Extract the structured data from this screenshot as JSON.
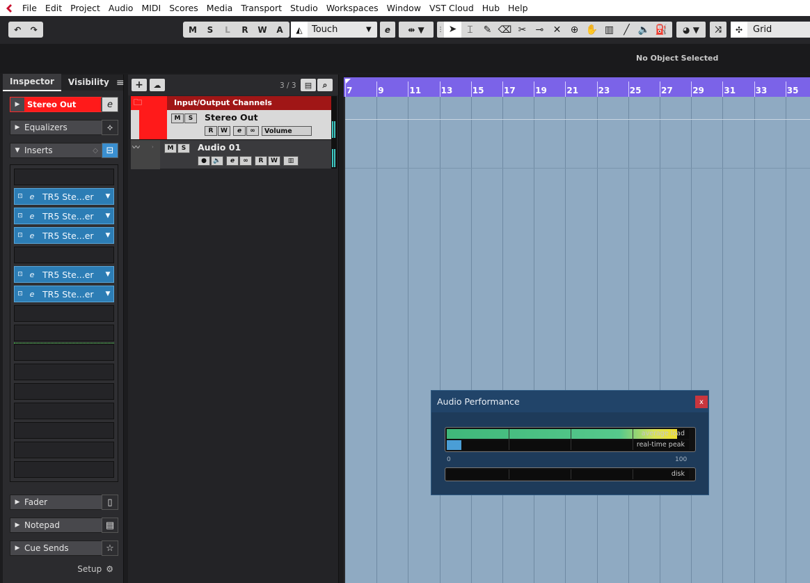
{
  "menu": [
    "File",
    "Edit",
    "Project",
    "Audio",
    "MIDI",
    "Scores",
    "Media",
    "Transport",
    "Studio",
    "Workspaces",
    "Window",
    "VST Cloud",
    "Hub",
    "Help"
  ],
  "toolbar": {
    "states": [
      "M",
      "S",
      "L",
      "R",
      "W",
      "A"
    ],
    "automation_mode": "Touch",
    "snap_mode": "Grid"
  },
  "infoline": {
    "status": "No Object Selected"
  },
  "inspector": {
    "tabs": [
      "Inspector",
      "Visibility"
    ],
    "track_name": "Stereo Out",
    "sections": {
      "equalizers": "Equalizers",
      "inserts": "Inserts",
      "fader": "Fader",
      "notepad": "Notepad",
      "cue_sends": "Cue Sends"
    },
    "insert_slots": [
      "",
      "TR5 Ste...er",
      "TR5 Ste...er",
      "TR5 Ste...er",
      "",
      "TR5 Ste...er",
      "TR5 Ste...er",
      "",
      "",
      "",
      "",
      "",
      "",
      "",
      "",
      ""
    ],
    "setup_label": "Setup"
  },
  "tracklist": {
    "count": "3 / 3",
    "folder_name": "Input/Output Channels",
    "tracks": [
      {
        "name": "Stereo Out",
        "param": "Volume"
      },
      {
        "name": "Audio 01"
      }
    ]
  },
  "ruler": {
    "bars": [
      "7",
      "9",
      "11",
      "13",
      "15",
      "17",
      "19",
      "21",
      "23",
      "25",
      "27",
      "29",
      "31",
      "33",
      "35"
    ]
  },
  "audio_performance": {
    "title": "Audio Performance",
    "close": "x",
    "average_load_label": "average load",
    "average_load": 0.95,
    "peak_label": "real-time peak",
    "peak": 0.06,
    "scale_min": "0",
    "scale_max": "100",
    "disk_label": "disk",
    "disk": 0.0
  },
  "colors": {
    "ruler": "#7b63e8",
    "project_bg": "#8faac2",
    "plugin": "#2c7db5",
    "stereo_out": "#ff1a1a"
  }
}
